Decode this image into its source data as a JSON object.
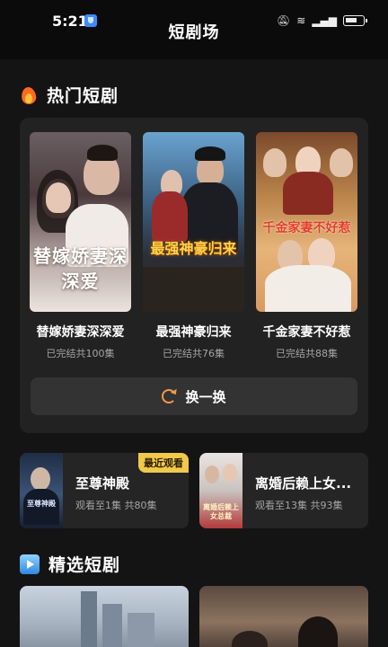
{
  "status_bar": {
    "time": "5:21"
  },
  "page": {
    "title": "短剧场"
  },
  "hot_section": {
    "title": "热门短剧",
    "dramas": [
      {
        "name": "替嫁娇妻深深爱",
        "meta": "已完结共100集",
        "poster_text": "替嫁娇妻深深爱"
      },
      {
        "name": "最强神豪归来",
        "meta": "已完结共76集",
        "poster_text": "最强神豪归来"
      },
      {
        "name": "千金家妻不好惹",
        "meta": "已完结共88集",
        "poster_text": "千金家妻不好惹"
      }
    ],
    "refresh_label": "换一换"
  },
  "recent": [
    {
      "name": "至尊神殿",
      "meta": "观看至1集 共80集",
      "badge": "最近观看",
      "poster_text": "至尊神殿"
    },
    {
      "name": "离婚后赖上女...",
      "meta": "观看至13集 共93集",
      "poster_text": "离婚后赖上女总裁"
    }
  ],
  "featured_section": {
    "title": "精选短剧"
  },
  "icons": {
    "hot": "fire-icon",
    "featured": "play-icon",
    "refresh": "refresh-icon"
  },
  "colors": {
    "background": "#141414",
    "accent": "#f29a4a",
    "badge": "#f0c94a"
  }
}
